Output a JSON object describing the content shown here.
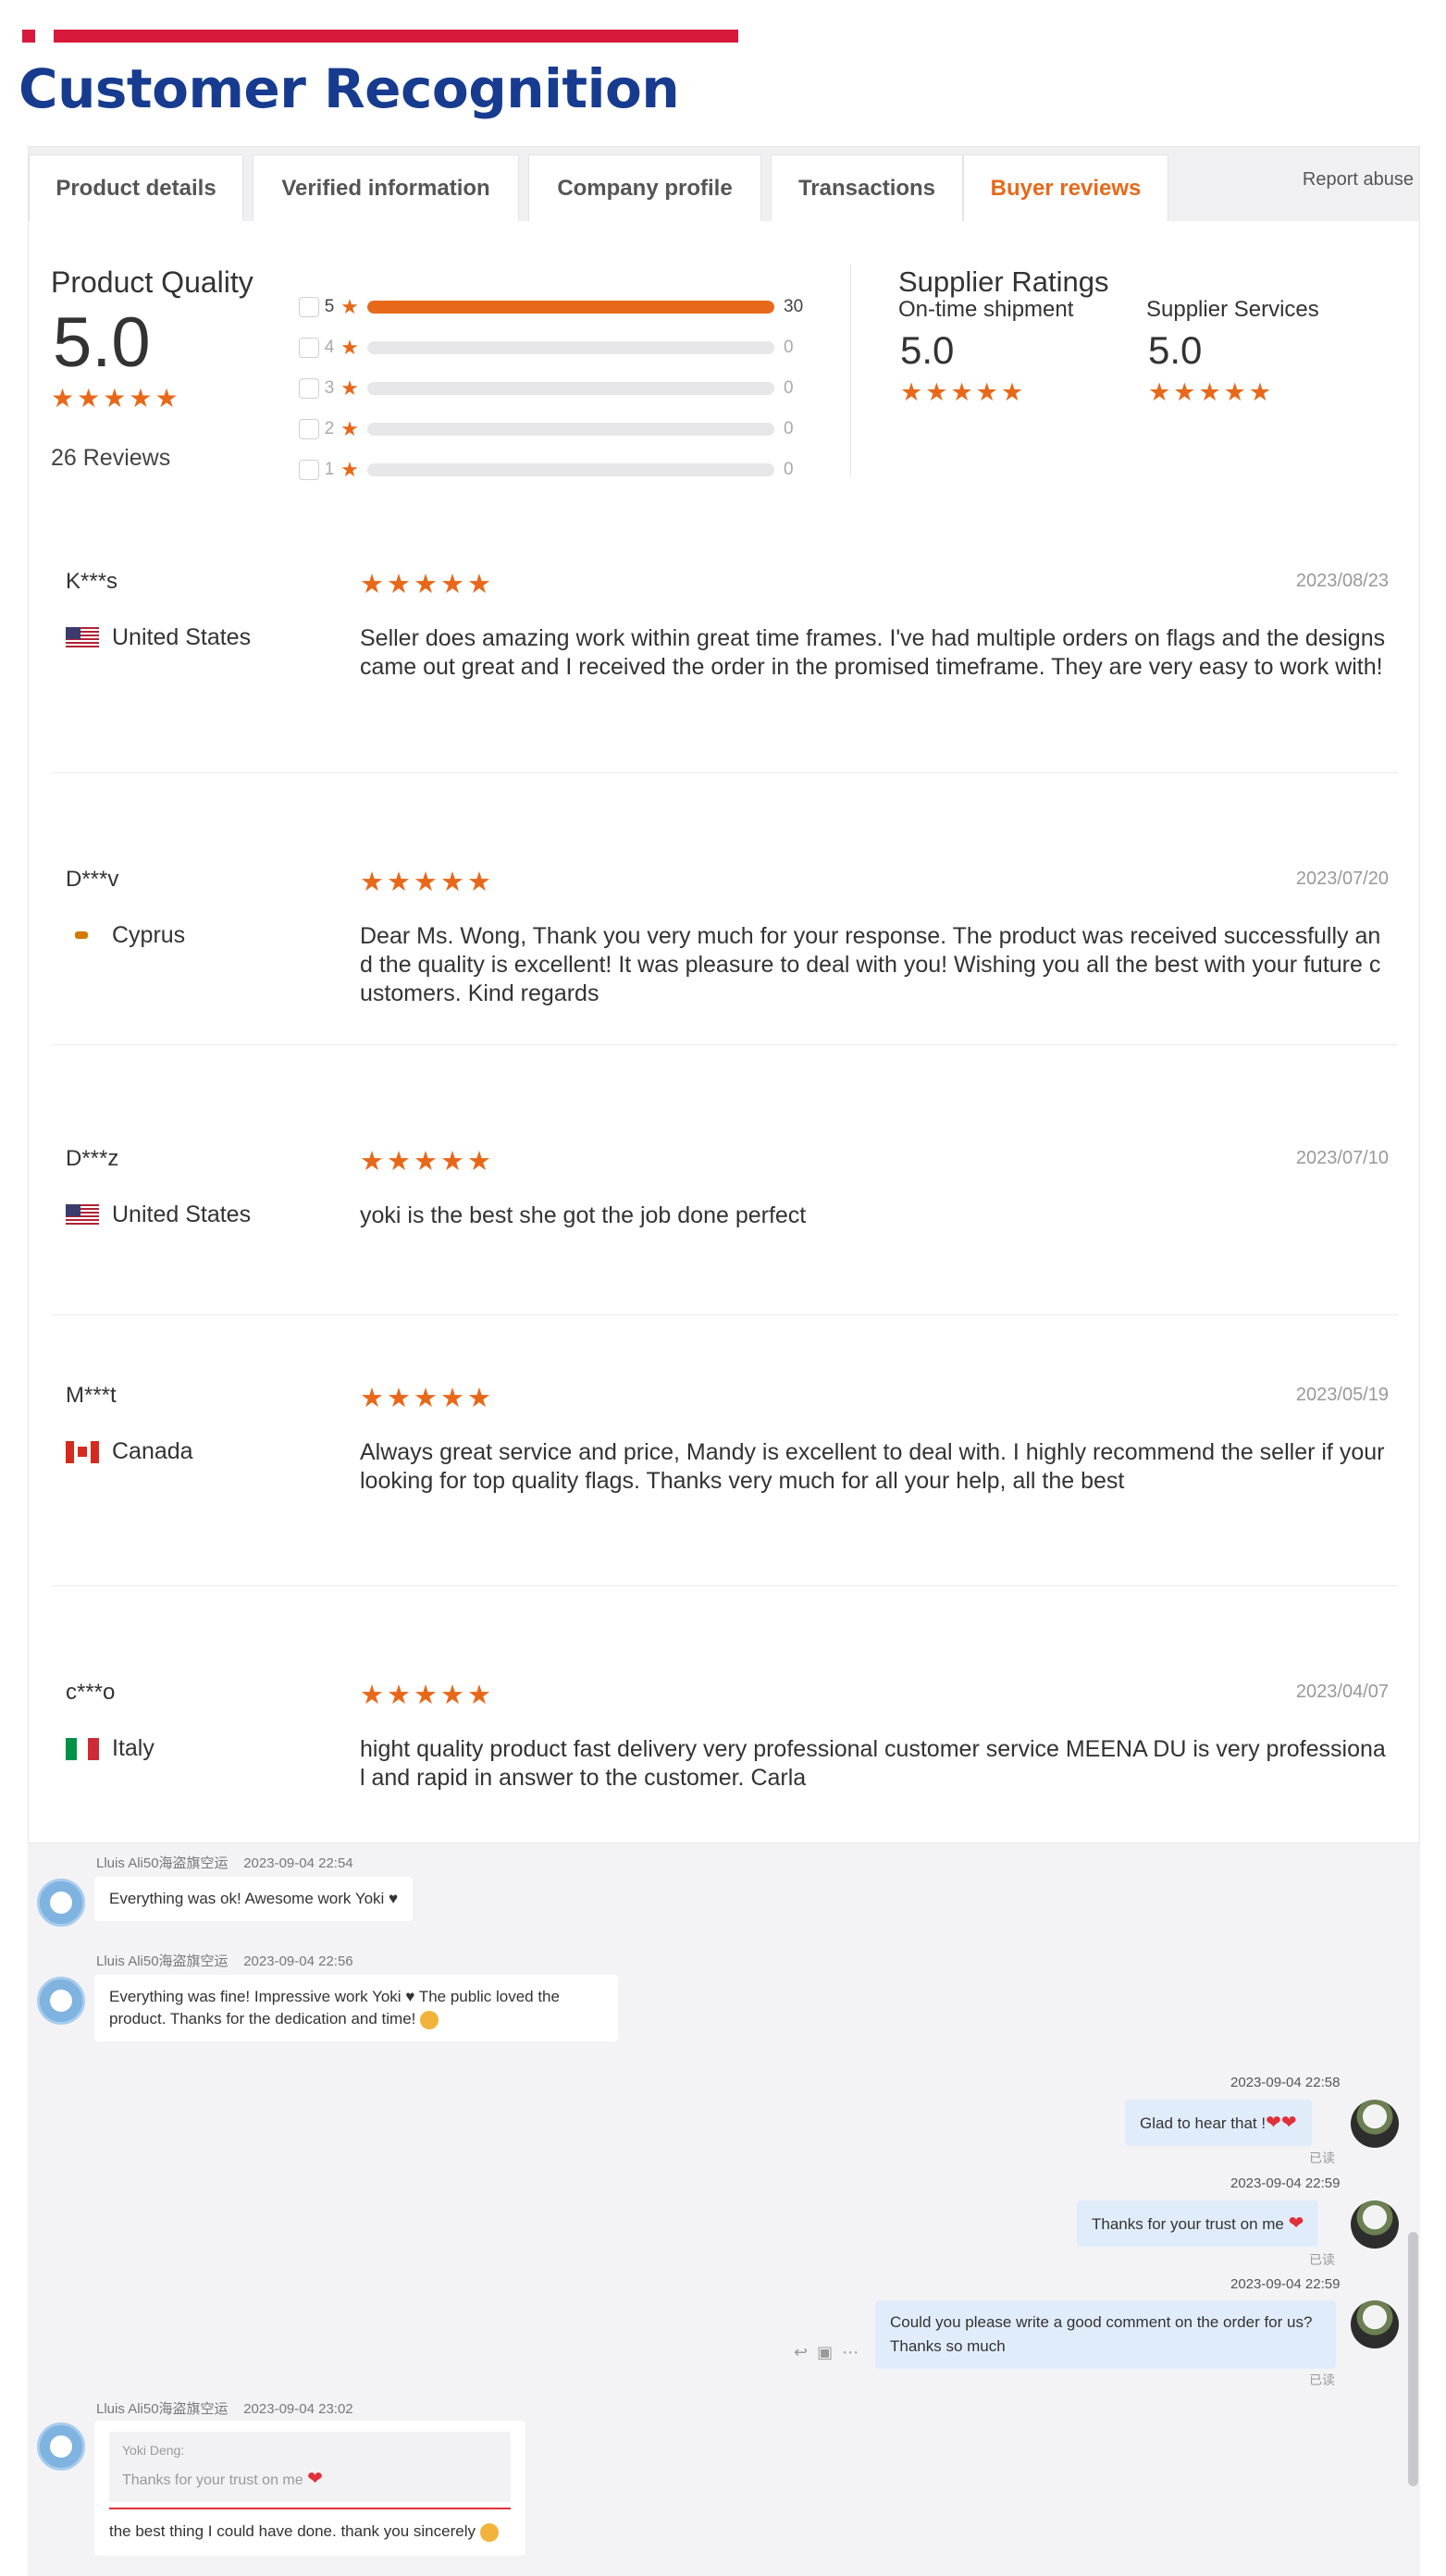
{
  "header": {
    "title": "Customer Recognition",
    "accent_color": "#d7193b",
    "title_color": "#173b8f"
  },
  "tabs": [
    {
      "label": "Product details",
      "active": false
    },
    {
      "label": "Verified information",
      "active": false
    },
    {
      "label": "Company profile",
      "active": false
    },
    {
      "label": "Transactions",
      "active": false
    },
    {
      "label": "Buyer reviews",
      "active": true
    }
  ],
  "report_abuse": "Report abuse",
  "summary": {
    "product_quality_label": "Product Quality",
    "product_quality_score": "5.0",
    "product_quality_stars": 5,
    "reviews_count": "26 Reviews",
    "distribution": [
      {
        "star": "5",
        "count": "30",
        "fraction": 1.0
      },
      {
        "star": "4",
        "count": "0",
        "fraction": 0
      },
      {
        "star": "3",
        "count": "0",
        "fraction": 0
      },
      {
        "star": "2",
        "count": "0",
        "fraction": 0
      },
      {
        "star": "1",
        "count": "0",
        "fraction": 0
      }
    ],
    "supplier_ratings_title": "Supplier Ratings",
    "ontime_label": "On-time shipment",
    "ontime_score": "5.0",
    "services_label": "Supplier Services",
    "services_score": "5.0",
    "star_color": "#e8681a"
  },
  "reviews": [
    {
      "name": "K***s",
      "country": "United States",
      "flag_icon": "us-flag-icon",
      "date": "2023/08/23",
      "stars": 5,
      "text": "Seller does amazing work within great time frames. I've had multiple orders on flags and the designs came out great and I received the order in the promised timeframe. They are very easy to work with!"
    },
    {
      "name": "D***v",
      "country": "Cyprus",
      "flag_icon": "cyprus-flag-icon",
      "date": "2023/07/20",
      "stars": 5,
      "text": "Dear Ms. Wong, Thank you very much for your response. The product was received successfully and the quality is excellent! It was pleasure to deal with you! Wishing you all the best with your future customers. Kind regards"
    },
    {
      "name": "D***z",
      "country": "United States",
      "flag_icon": "us-flag-icon",
      "date": "2023/07/10",
      "stars": 5,
      "text": "yoki is the best she got the job done perfect"
    },
    {
      "name": "M***t",
      "country": "Canada",
      "flag_icon": "canada-flag-icon",
      "date": "2023/05/19",
      "stars": 5,
      "text": "Always great service and price, Mandy is excellent to deal with. I highly recommend the seller if your looking for top quality flags. Thanks very much for all your help, all the best"
    },
    {
      "name": "c***o",
      "country": "Italy",
      "flag_icon": "italy-flag-icon",
      "date": "2023/04/07",
      "stars": 5,
      "text": "hight quality product fast delivery very professional customer service MEENA DU is very professional and rapid in answer to the customer. Carla"
    }
  ],
  "chat": {
    "m1": {
      "sender": "Lluis Ali50海盗旗空运",
      "time": "2023-09-04 22:54",
      "text": "Everything was ok! Awesome work Yoki ♥"
    },
    "m2": {
      "sender": "Lluis Ali50海盗旗空运",
      "time": "2023-09-04 22:56",
      "text_line1": "Everything was fine! Impressive work Yoki ♥ The public loved the",
      "text_line2": "product. Thanks for the dedication and time!"
    },
    "m3": {
      "time": "2023-09-04 22:58",
      "text": "Glad to hear that !",
      "read": "已读"
    },
    "m4": {
      "time": "2023-09-04 22:59",
      "text": "Thanks for your trust on me",
      "read": "已读"
    },
    "m5": {
      "time": "2023-09-04 22:59",
      "text_line1": "Could you please write a good comment on the order for us?",
      "text_line2": "Thanks so much",
      "read": "已读"
    },
    "m6": {
      "sender": "Lluis Ali50海盗旗空运",
      "time": "2023-09-04 23:02",
      "quote_author": "Yoki Deng:",
      "quote_text": "Thanks for your trust on me",
      "text": "the best thing I could have done. thank you sincerely"
    }
  }
}
